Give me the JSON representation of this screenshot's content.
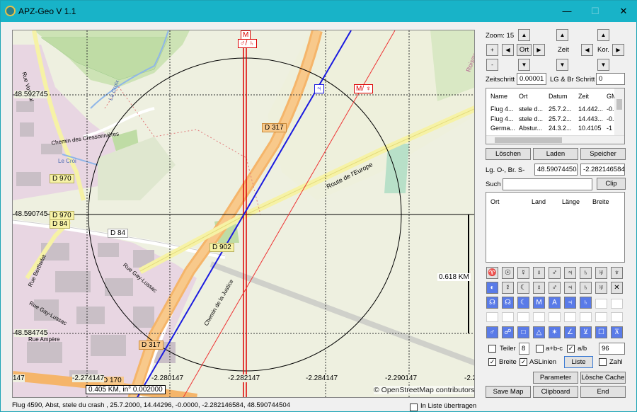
{
  "window": {
    "title": "APZ-Geo V 1.1",
    "minimize": "—",
    "maximize": "☐",
    "close": "✕"
  },
  "map": {
    "coords_y": [
      "48.592745",
      "48.590745",
      "48.584745"
    ],
    "coords_x": [
      "147",
      "-2.274147",
      "-2.280147",
      "-2.282147",
      "-2.284147",
      "-2.290147",
      "-2.2"
    ],
    "scale_text": "0.618 KM",
    "bottom_text": "0.405 KM, in° 0.002000",
    "attribution": "© OpenStreetMap contributors",
    "marker_top": "M",
    "marker_sym": "♂/ ♄",
    "marker_blue": "♃",
    "marker_red": "M/ ♆",
    "labels": {
      "d317a": "D 317",
      "d317b": "D 317",
      "d970a": "D 970",
      "d970b": "D 970",
      "d84a": "D 84",
      "d84b": "D 84",
      "d902": "D 902",
      "d170": "D 170",
      "europe": "Route de l'Europe",
      "cresson": "Chemin des Cressonnières",
      "justice": "Chemin de la Justice",
      "lecroi": "Le Croi",
      "gaylussac": "Rue Gay-Lussac",
      "gaylussac2": "Rue Gay-Lussac",
      "berthelot": "Rue Berthelot",
      "ampere": "Rue Ampère",
      "voisnal": "Rue Voisnal",
      "lacroix": "La Croix",
      "roissy": "Roissy-en-France"
    }
  },
  "status": "Flug 4590, Abst, stele du crash , 25.7.2000, 14.44296, -0.0000, -2.282146584, 48.590744504",
  "in_liste": "In Liste übertragen",
  "panel": {
    "zoom_label": "Zoom: 15",
    "plus": "+",
    "minus": "-",
    "ort": "Ort",
    "zeit": "Zeit",
    "kor": "Kor.",
    "zeitschritt_label": "Zeitschritt",
    "zeitschritt_val": "0.00001",
    "lgbr_label": "LG & Br Schritt",
    "lgbr_val": "0",
    "list1_headers": [
      "Name",
      "Ort",
      "Datum",
      "Zeit",
      "GM"
    ],
    "list1_rows": [
      [
        "Flug 4...",
        "stele d...",
        "25.7.2...",
        "14.442...",
        "-0."
      ],
      [
        "Flug 4...",
        "stele d...",
        "25.7.2...",
        "14.443...",
        "-0."
      ],
      [
        "Germa...",
        "Abstur...",
        "24.3.2...",
        "10.4105",
        "-1"
      ]
    ],
    "loeschen": "Löschen",
    "laden": "Laden",
    "speicher": "Speicher",
    "lg_label": "Lg. O-, Br. S-",
    "lg_val": "48.590744504",
    "br_val": "-2.282146584",
    "suche_label": "Suche",
    "clip": "Clip",
    "list2_headers": [
      "Ort",
      "Land",
      "Länge",
      "Breite"
    ],
    "sym_row1": [
      "♈",
      "☉",
      "☿",
      "♀",
      "♂",
      "♃",
      "♄",
      "♅",
      "♆"
    ],
    "sym_row2": [
      "◐",
      "☿",
      "☾",
      "♀",
      "♂",
      "♃",
      "♄",
      "♅",
      "✕"
    ],
    "sym_row3": [
      "☊",
      "☊",
      "☾",
      "M",
      "A",
      "♃",
      "♄"
    ],
    "sym_row4": [
      "♂",
      "☍",
      "□",
      "△",
      "✶",
      "∠",
      "⊻",
      "☐",
      "⊼"
    ],
    "teiler": "Teiler",
    "teiler_val": "8",
    "abc": "a+b-c",
    "ab": "a/b",
    "ab_val": "96",
    "breite": "Breite",
    "aslinien": "ASLinien",
    "liste": "Liste",
    "zahl": "Zahl",
    "parameter": "Parameter",
    "loesche_cache": "Lösche Cache",
    "save_map": "Save Map",
    "clipboard": "Clipboard",
    "end": "End"
  }
}
